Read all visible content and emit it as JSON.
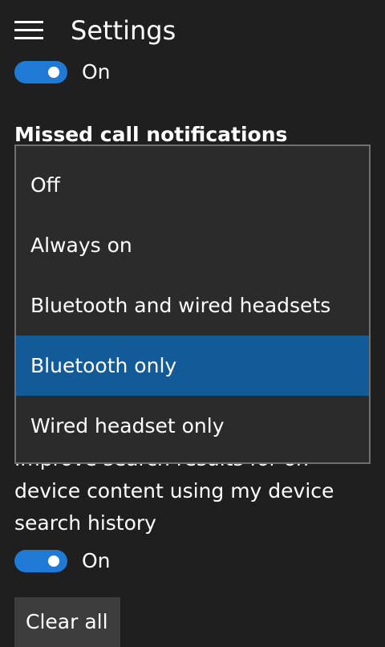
{
  "header": {
    "title": "Settings",
    "menu_icon": "hamburger-icon"
  },
  "toggle_top": {
    "label": "On",
    "state": true
  },
  "missed_call": {
    "heading": "Missed call notifications",
    "options": [
      "Off",
      "Always on",
      "Bluetooth and wired headsets",
      "Bluetooth only",
      "Wired headset only"
    ],
    "selected": "Bluetooth only"
  },
  "search_history": {
    "text": "Improve search results for on device content using my device search history",
    "toggle_label": "On",
    "state": true
  },
  "clear_button": {
    "label": "Clear all"
  },
  "colors": {
    "background": "#1f1f1f",
    "accent": "#1e7ad4",
    "selected": "#135a98"
  }
}
